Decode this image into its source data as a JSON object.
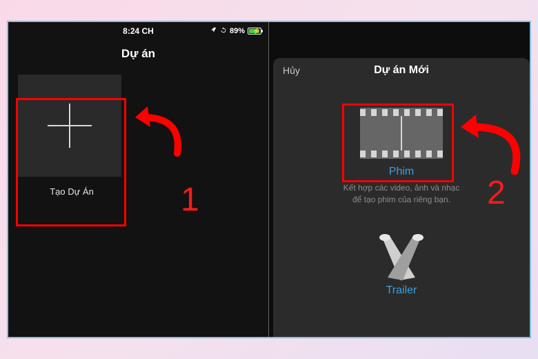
{
  "colors": {
    "highlight": "#ff0000",
    "link": "#3aa0df"
  },
  "statusbar": {
    "time": "8:24 CH",
    "battery_percent": "89%",
    "location_icon": "location-icon",
    "refresh_icon": "sync-icon"
  },
  "left": {
    "title": "Dự án",
    "create": {
      "label": "Tạo Dự Án"
    }
  },
  "right": {
    "cancel": "Hủy",
    "title": "Dự án Mới",
    "options": {
      "movie": {
        "title": "Phim",
        "desc": "Kết hợp các video, ảnh và nhạc\nđể tạo phim của riêng bạn."
      },
      "trailer": {
        "title": "Trailer"
      }
    }
  },
  "annotations": {
    "step1": "1",
    "step2": "2"
  }
}
